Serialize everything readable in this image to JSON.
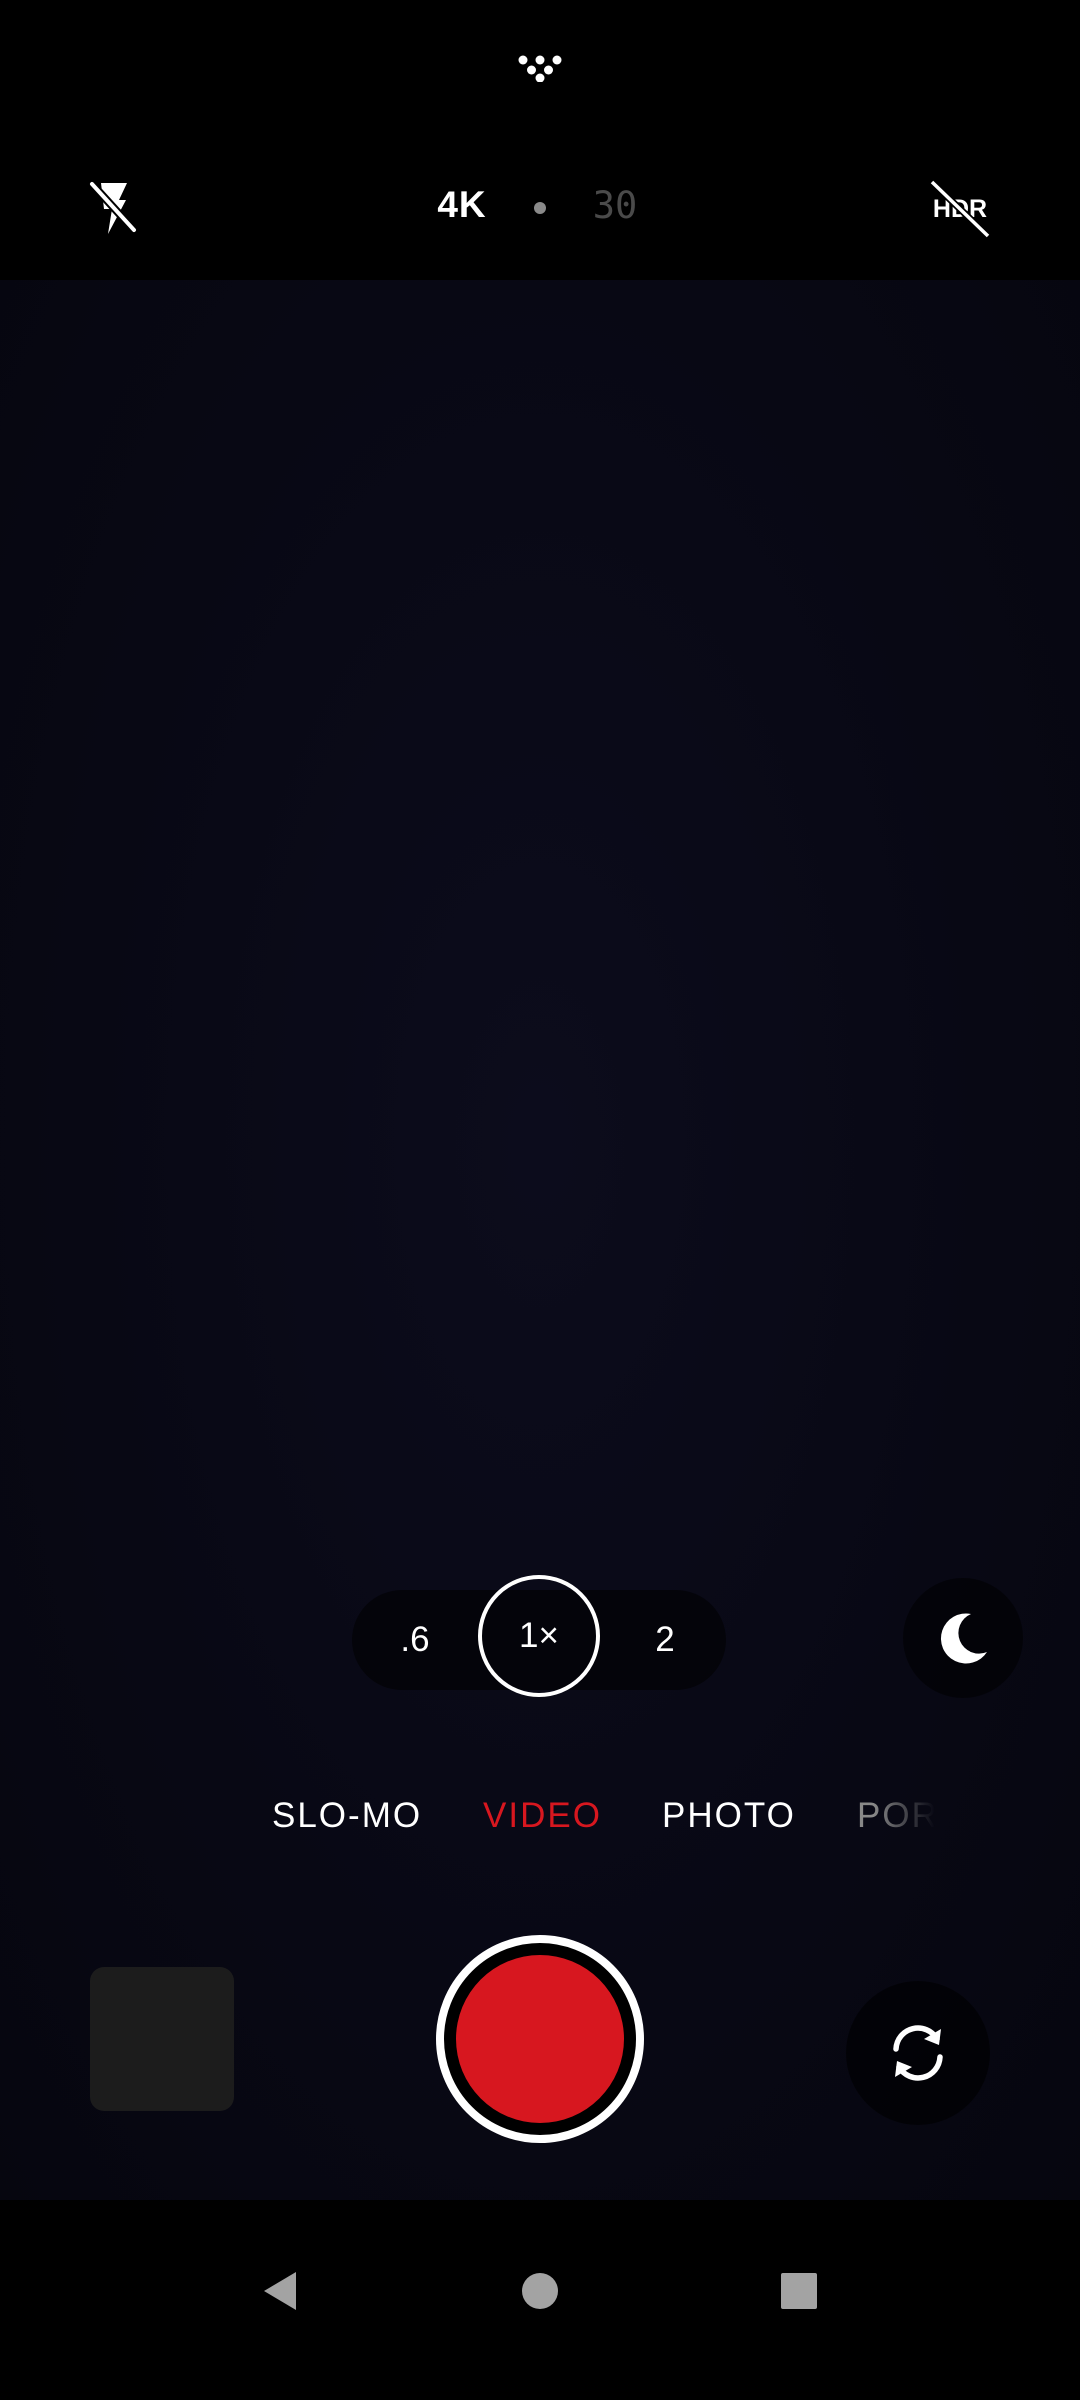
{
  "top_bar": {
    "more_icon": "more-dots-icon",
    "flash_icon": "flash-off-icon",
    "resolution": "4K",
    "frame_rate": "30",
    "hdr_icon": "hdr-off-icon"
  },
  "zoom": {
    "options": [
      ".6",
      "1×",
      "2"
    ],
    "selected": "1×",
    "night_icon": "moon-icon"
  },
  "modes": {
    "items": [
      "SLO-MO",
      "VIDEO",
      "PHOTO",
      "POR"
    ],
    "active": "VIDEO"
  },
  "controls": {
    "gallery_icon": "gallery-thumbnail",
    "record_icon": "record-button",
    "flip_icon": "flip-camera-icon"
  },
  "nav": {
    "back_icon": "back-icon",
    "home_icon": "home-icon",
    "recents_icon": "recents-icon"
  },
  "colors": {
    "accent": "#d7171f",
    "background": "#000000",
    "viewfinder": "#080814"
  }
}
